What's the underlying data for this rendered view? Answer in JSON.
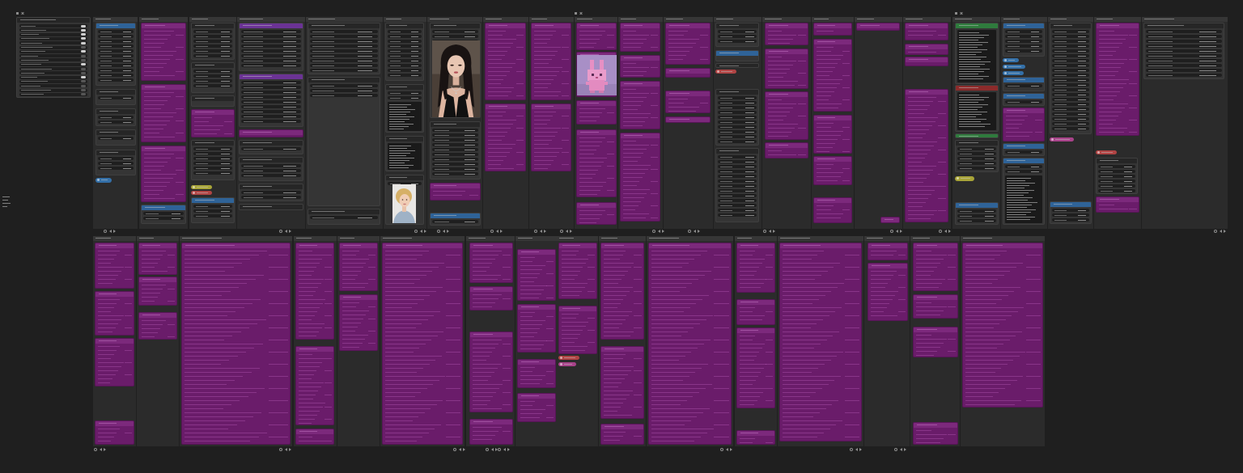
{
  "canvas": {
    "background": "#1f1f1f"
  },
  "colors": {
    "group_background": "#2b2b2b",
    "group_title_bar": "#363636",
    "node_body": "#353535",
    "node_title": "#262626",
    "widget": "#1f1f1f",
    "text_area": "#1a1a1a",
    "bypassed_body": "#6a1c6a",
    "bypassed_title": "#7c297c",
    "blue_title": "#2f6398",
    "green_title": "#2f7b3d",
    "red_title": "#8c2b2b",
    "violet_title": "#6b3395",
    "yellow_pill": "#a8a438",
    "red_pill": "#b04444",
    "blue_pill": "#3470a8",
    "pink_pill": "#a8438a"
  },
  "icons": {
    "group_toolbar": [
      "fit-view-icon",
      "chevron-left-icon",
      "chevron-right-icon"
    ],
    "group_marker": [
      "group-bullet-icon",
      "close-icon"
    ],
    "toggle": "toggle-switch-icon"
  }
}
